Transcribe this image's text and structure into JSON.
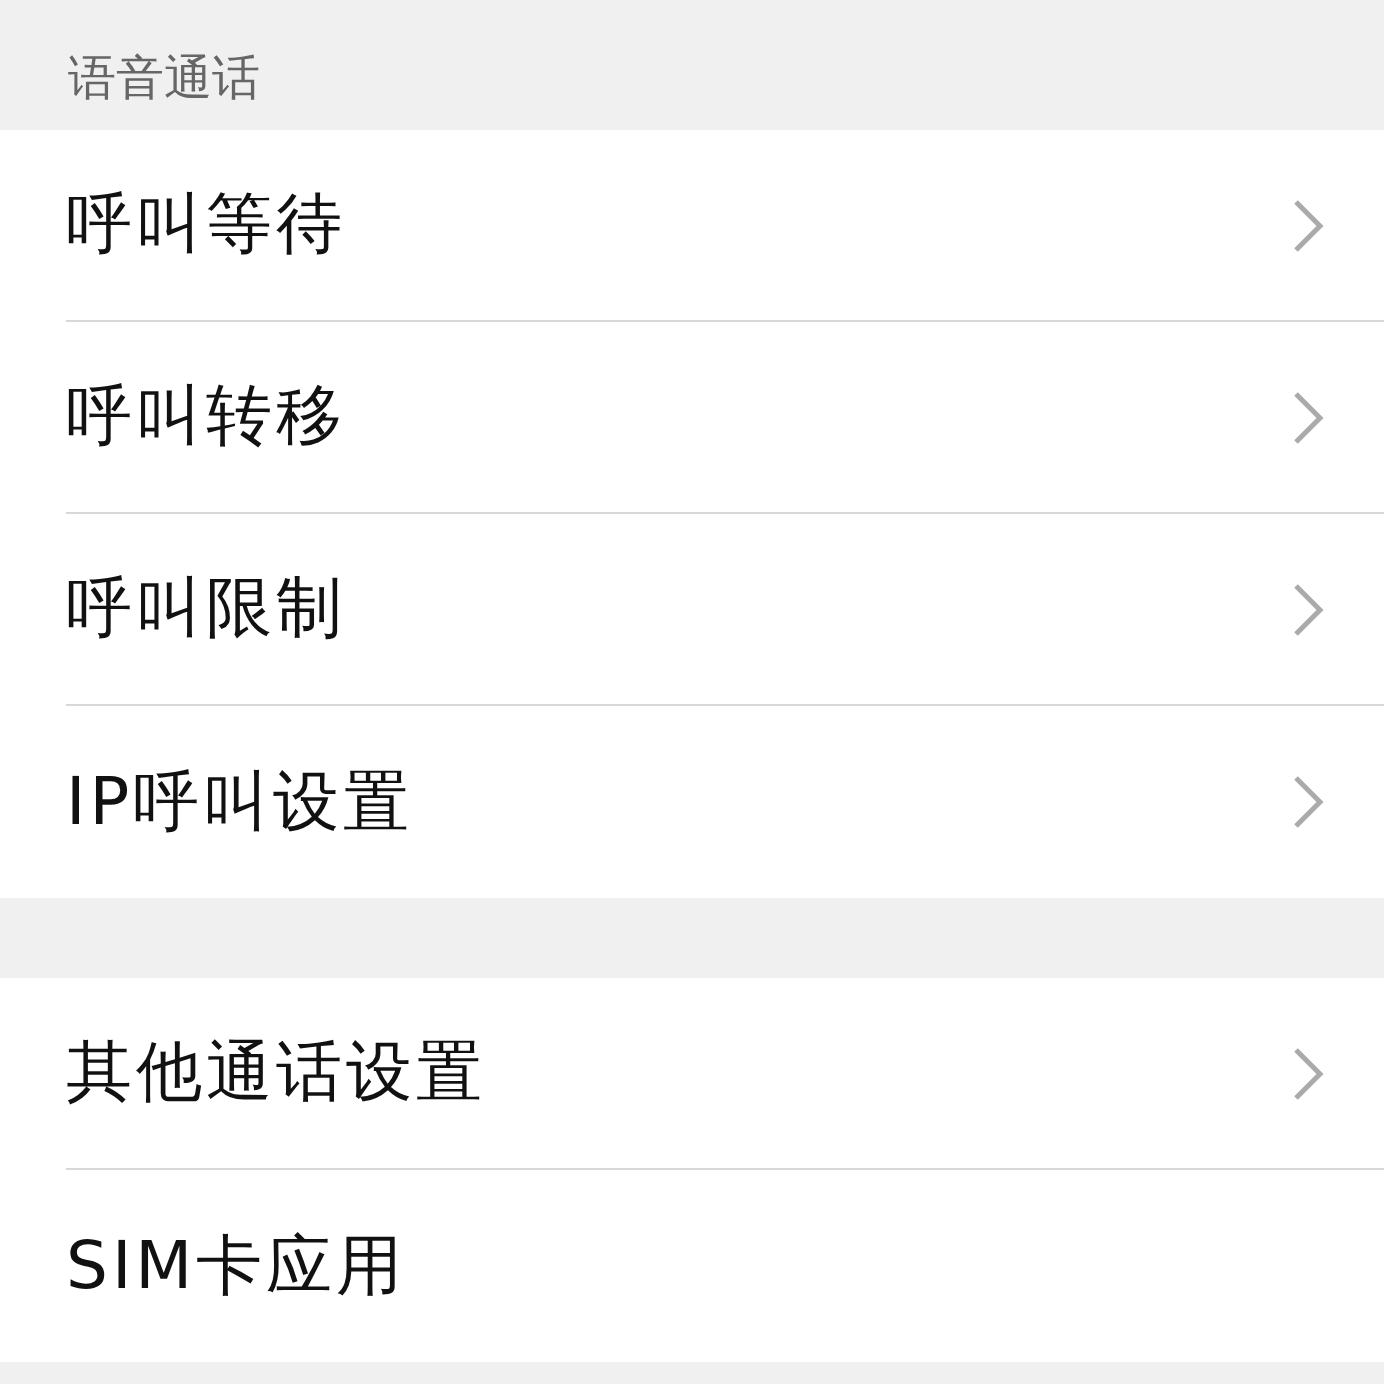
{
  "section_title": "语音通话",
  "groups": [
    {
      "items": [
        {
          "label": "呼叫等待",
          "chevron": true
        },
        {
          "label": "呼叫转移",
          "chevron": true
        },
        {
          "label": "呼叫限制",
          "chevron": true
        },
        {
          "label": "IP呼叫设置",
          "chevron": true
        }
      ]
    },
    {
      "items": [
        {
          "label": "其他通话设置",
          "chevron": true
        },
        {
          "label": "SIM卡应用",
          "chevron": false
        }
      ]
    }
  ]
}
